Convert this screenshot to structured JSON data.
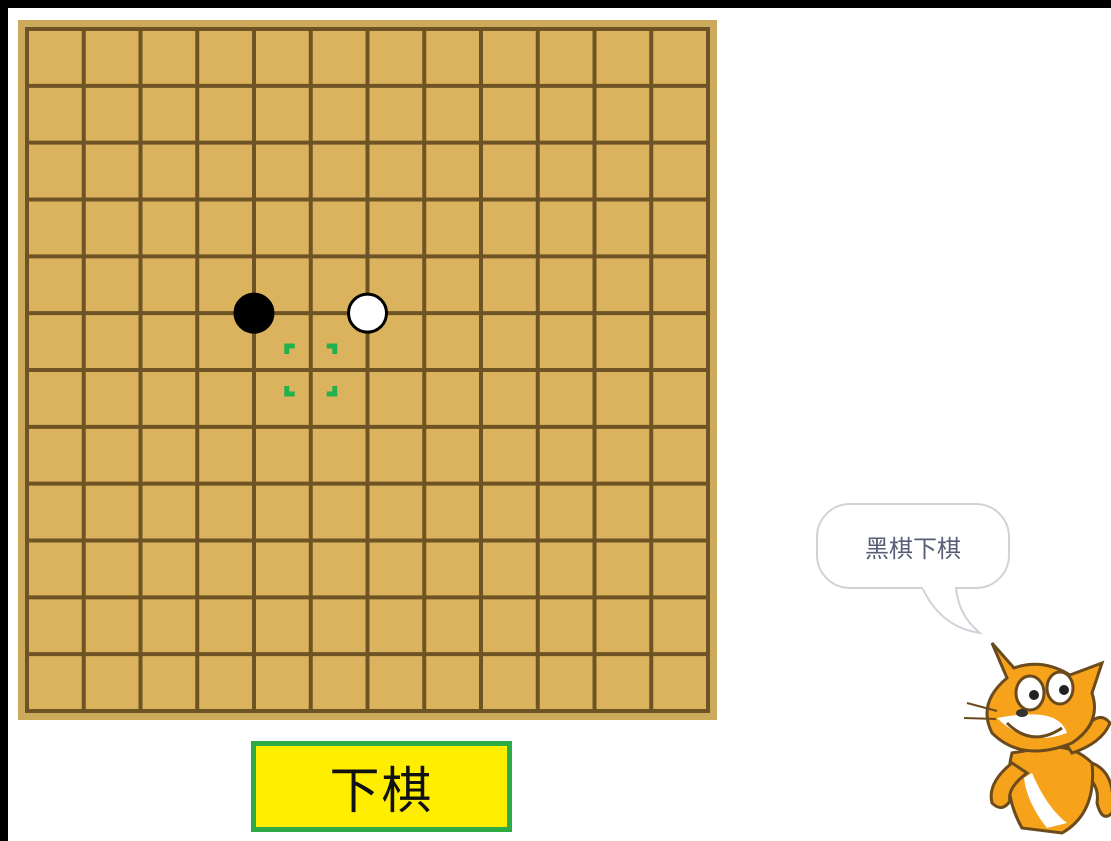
{
  "board": {
    "cells": 12,
    "line_color": "#6e5424",
    "fill_color": "#dbb35f",
    "stones": [
      {
        "color": "black",
        "col": 4,
        "row": 5
      },
      {
        "color": "white",
        "col": 6,
        "row": 5
      }
    ],
    "cursor": {
      "col": 5,
      "row": 6,
      "color": "#22b14c"
    }
  },
  "play_button": {
    "label": "下棋",
    "bg_color": "#ffee00",
    "border_color": "#2eab44"
  },
  "speech_bubble": {
    "text": "黑棋下棋"
  },
  "sprite": {
    "icon": "scratch-cat-icon"
  }
}
